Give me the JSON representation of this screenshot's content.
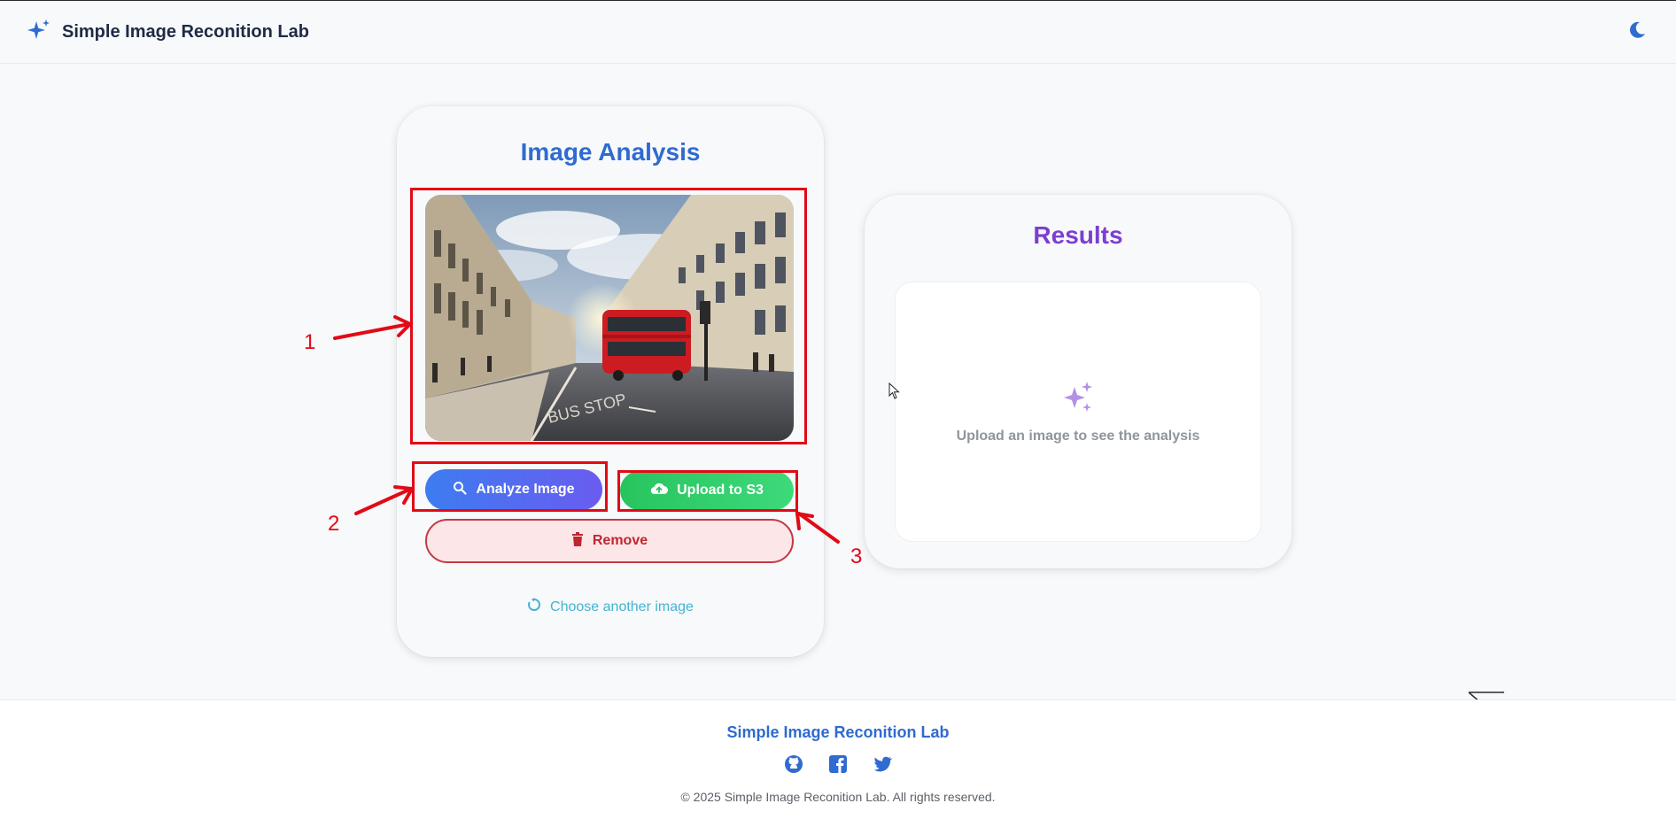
{
  "header": {
    "brand_title": "Simple Image Reconition Lab",
    "brand_icon": "sparkles-icon",
    "theme_icon": "moon-icon"
  },
  "analysis_card": {
    "title": "Image Analysis",
    "image_alt": "Regent Street London with red double-decker bus",
    "analyze_label": "Analyze Image",
    "upload_label": "Upload to S3",
    "remove_label": "Remove",
    "choose_label": "Choose another image"
  },
  "results_card": {
    "title": "Results",
    "placeholder": "Upload an image to see the analysis"
  },
  "annotations": [
    "1",
    "2",
    "3"
  ],
  "footer": {
    "title": "Simple Image Reconition Lab",
    "social": [
      "github-icon",
      "facebook-icon",
      "twitter-icon"
    ],
    "copyright": "© 2025 Simple Image Reconition Lab. All rights reserved."
  },
  "colors": {
    "primary": "#2f6bd0",
    "results_title": "#7b3fd0",
    "analyze_gradient_start": "#3d7cf0",
    "upload_green": "#27c45e",
    "remove_red": "#c33a44",
    "annotation_red": "#e10a16"
  }
}
